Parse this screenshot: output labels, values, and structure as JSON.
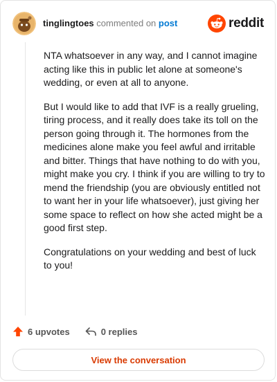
{
  "header": {
    "username": "tinglingtoes",
    "action_text": "commented on",
    "link_text": "post",
    "brand_name": "reddit"
  },
  "comment": {
    "paragraphs": [
      "NTA whatsoever in any way, and I cannot imagine acting like this in public let alone at someone's wedding, or even at all to anyone.",
      "But I would like to add that IVF is a really grueling, tiring process, and it really does take its toll on the person going through it. The hormones from the medicines alone make you feel awful and irritable and bitter. Things that have nothing to do with you, might make you cry. I think if you are willing to try to mend the friendship (you are obviously entitled not to want her in your life whatsoever), just giving her some space to reflect on how she acted might be a good first step.",
      "Congratulations on your wedding and best of luck to you!"
    ]
  },
  "footer": {
    "upvotes_label": "6 upvotes",
    "replies_label": "0 replies"
  },
  "cta": {
    "label": "View the conversation"
  },
  "colors": {
    "brand_orange": "#ff4500",
    "link_blue": "#0079d3",
    "cta_text": "#d93a00",
    "upvote_orange": "#ff4500"
  },
  "icons": {
    "avatar": "avatar-icon",
    "logo": "reddit-logo-icon",
    "upvote": "upvote-arrow-icon",
    "reply": "reply-arrow-icon"
  }
}
